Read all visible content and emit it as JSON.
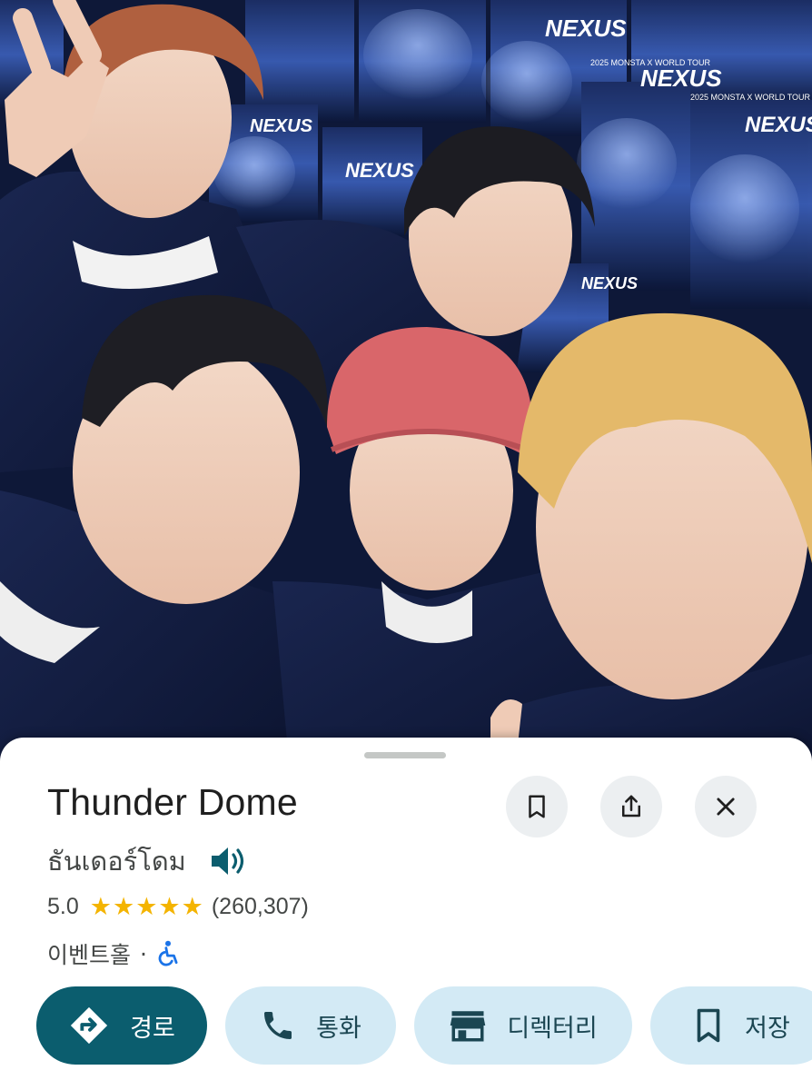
{
  "place": {
    "name": "Thunder Dome",
    "native_name": "ธันเดอร์โดม",
    "rating": "5.0",
    "stars": 5,
    "review_count": "(260,307)",
    "category": "이벤트홀",
    "separator": "·"
  },
  "header_buttons": {
    "save_icon": "bookmark-icon",
    "share_icon": "share-icon",
    "close_icon": "close-icon"
  },
  "actions": {
    "directions": "경로",
    "call": "통화",
    "directory": "디렉터리",
    "save": "저장"
  },
  "poster_text": {
    "logo": "NEXUS",
    "tour": "2025 MONSTA X WORLD TOUR"
  },
  "colors": {
    "primary": "#0b5d6e",
    "chip": "#d3eaf5",
    "star": "#f4b400",
    "accessible": "#1a73e8"
  }
}
